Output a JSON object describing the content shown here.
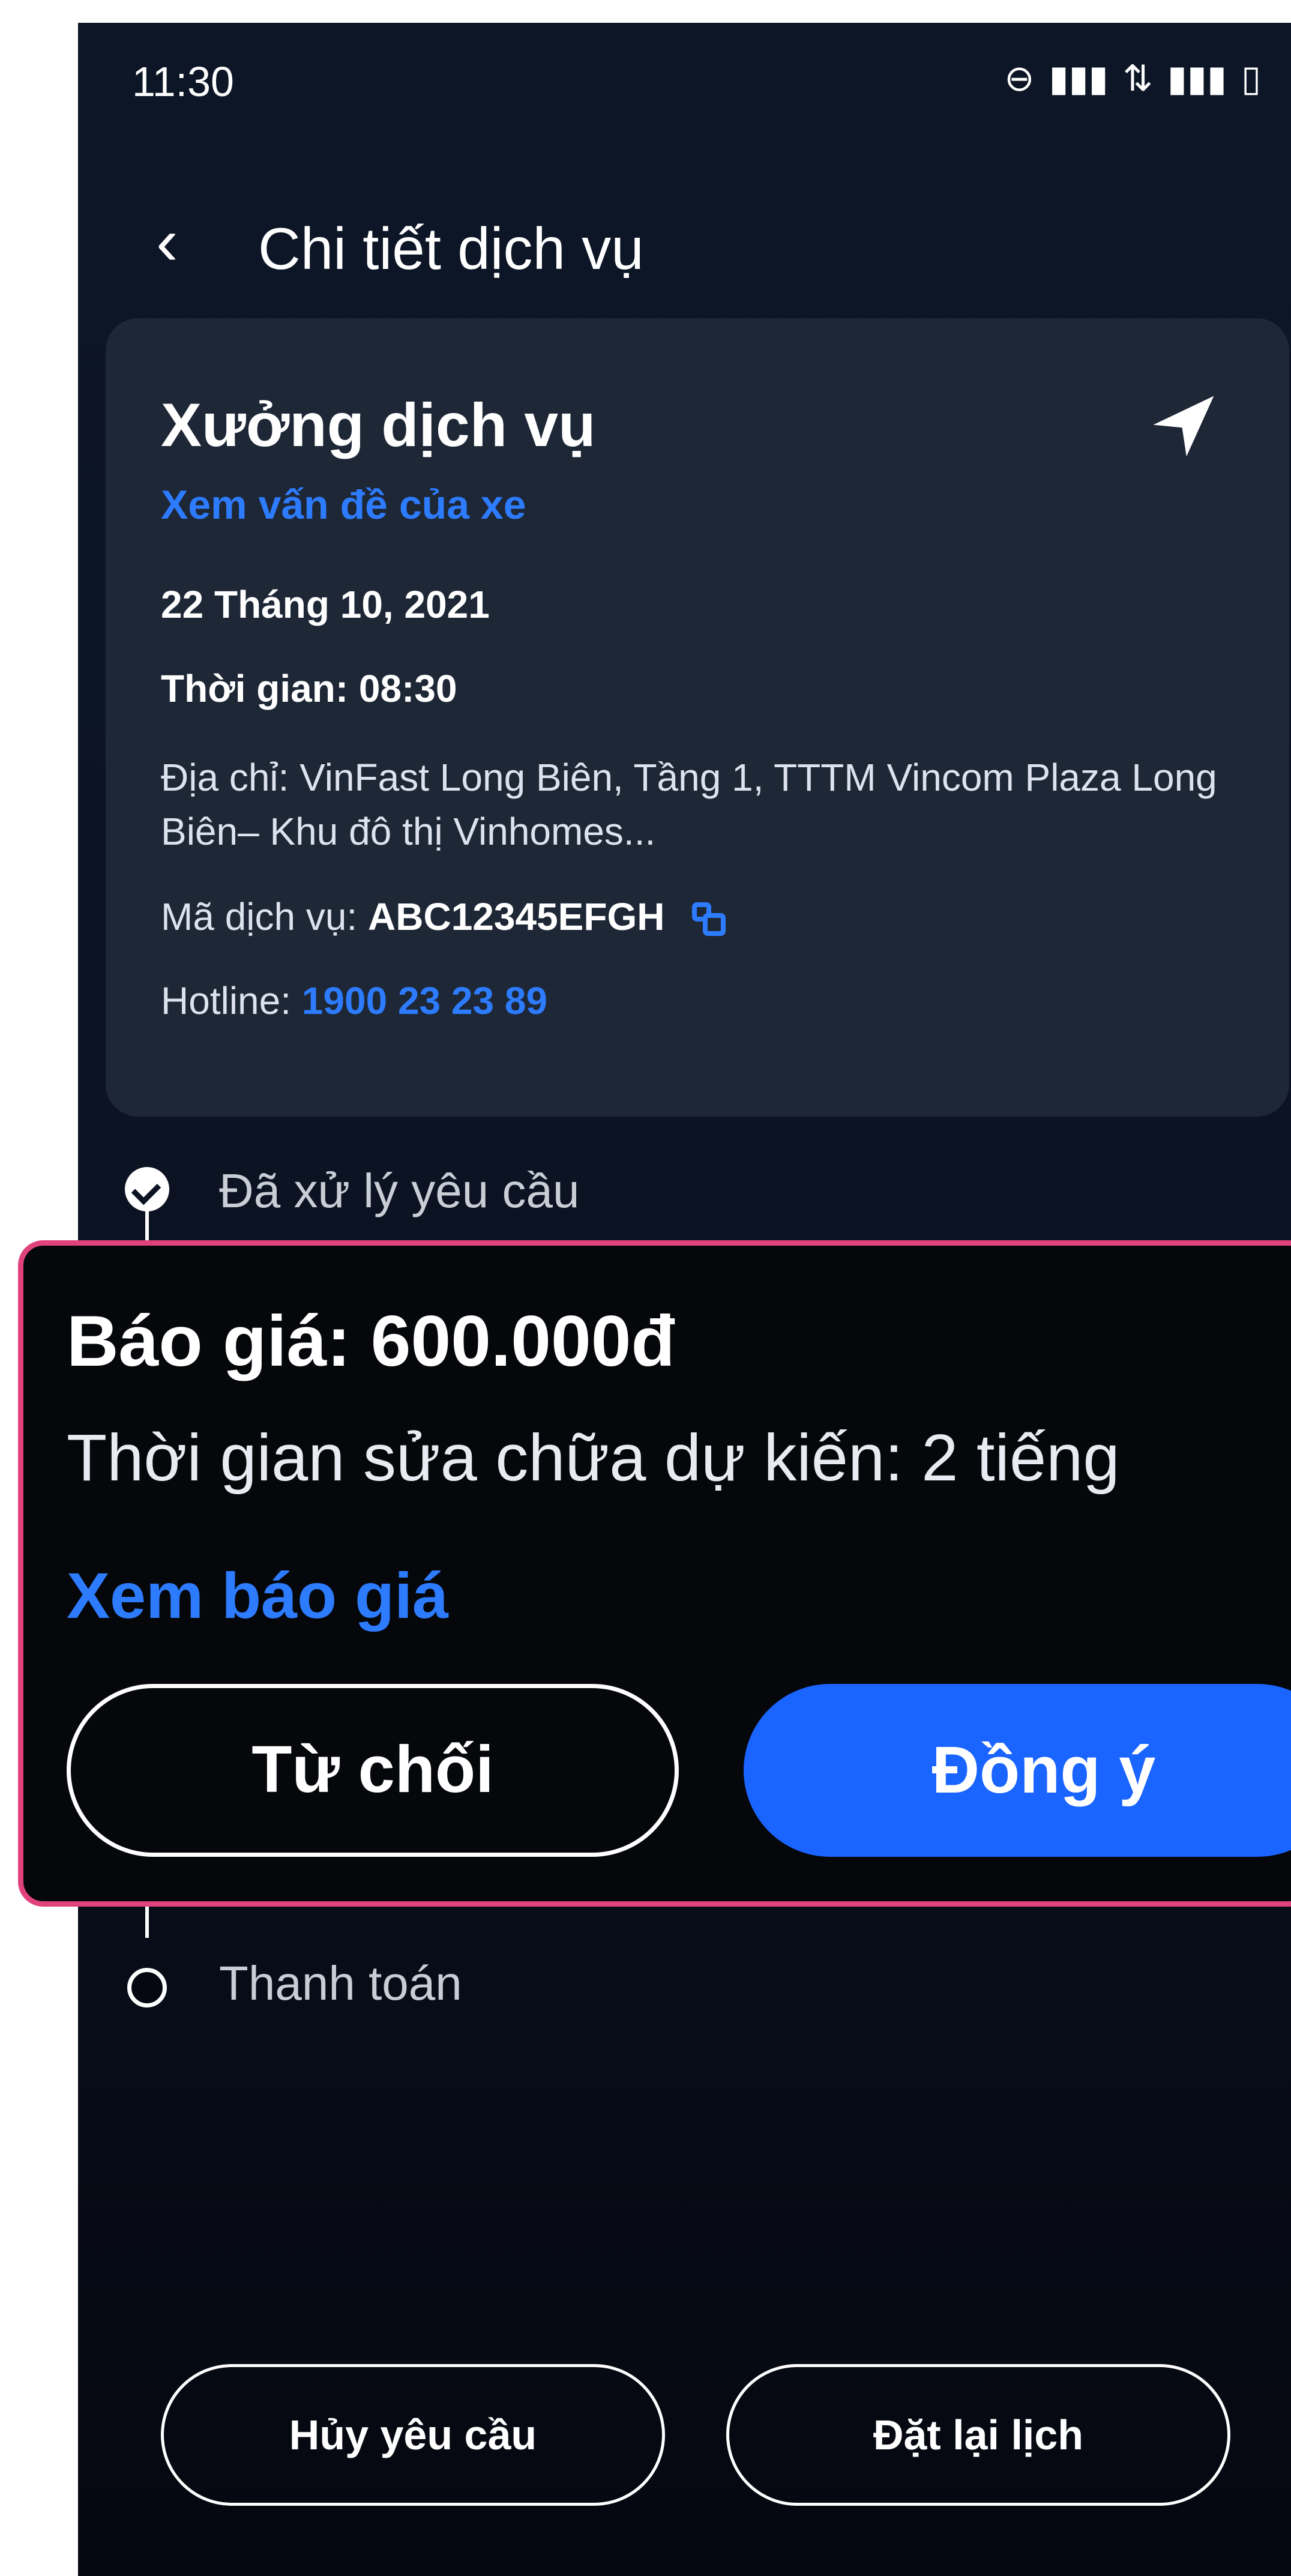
{
  "status": {
    "time": "11:30",
    "icons": [
      "do-not-disturb-icon",
      "signal-icon",
      "4g-icon",
      "signal-icon",
      "battery-icon"
    ]
  },
  "header": {
    "title": "Chi tiết dịch vụ"
  },
  "service_card": {
    "title": "Xưởng dịch vụ",
    "issue_link": "Xem vấn đề của xe",
    "date": "22 Tháng 10, 2021",
    "time": "Thời gian: 08:30",
    "address": "Địa chỉ: VinFast Long Biên, Tầng 1, TTTM Vincom Plaza Long Biên– Khu đô thị Vinhomes...",
    "code_label": "Mã dịch vụ:",
    "code_value": "ABC12345EFGH",
    "hotline_label": "Hotline:",
    "hotline_value": "1900 23 23 89"
  },
  "timeline": {
    "step1": "Đã xử lý yêu cầu",
    "step3": "Thanh toán"
  },
  "quote_popup": {
    "title": "Báo giá: 600.000đ",
    "estimate": "Thời gian sửa chữa dự kiến: 2 tiếng",
    "view_link": "Xem báo giá",
    "decline": "Từ chối",
    "accept": "Đồng ý"
  },
  "footer": {
    "cancel": "Hủy yêu cầu",
    "reschedule": "Đặt lại lịch"
  },
  "colors": {
    "accent": "#2d7bff",
    "highlight_border": "#e0427c",
    "background": "#0c1424"
  }
}
